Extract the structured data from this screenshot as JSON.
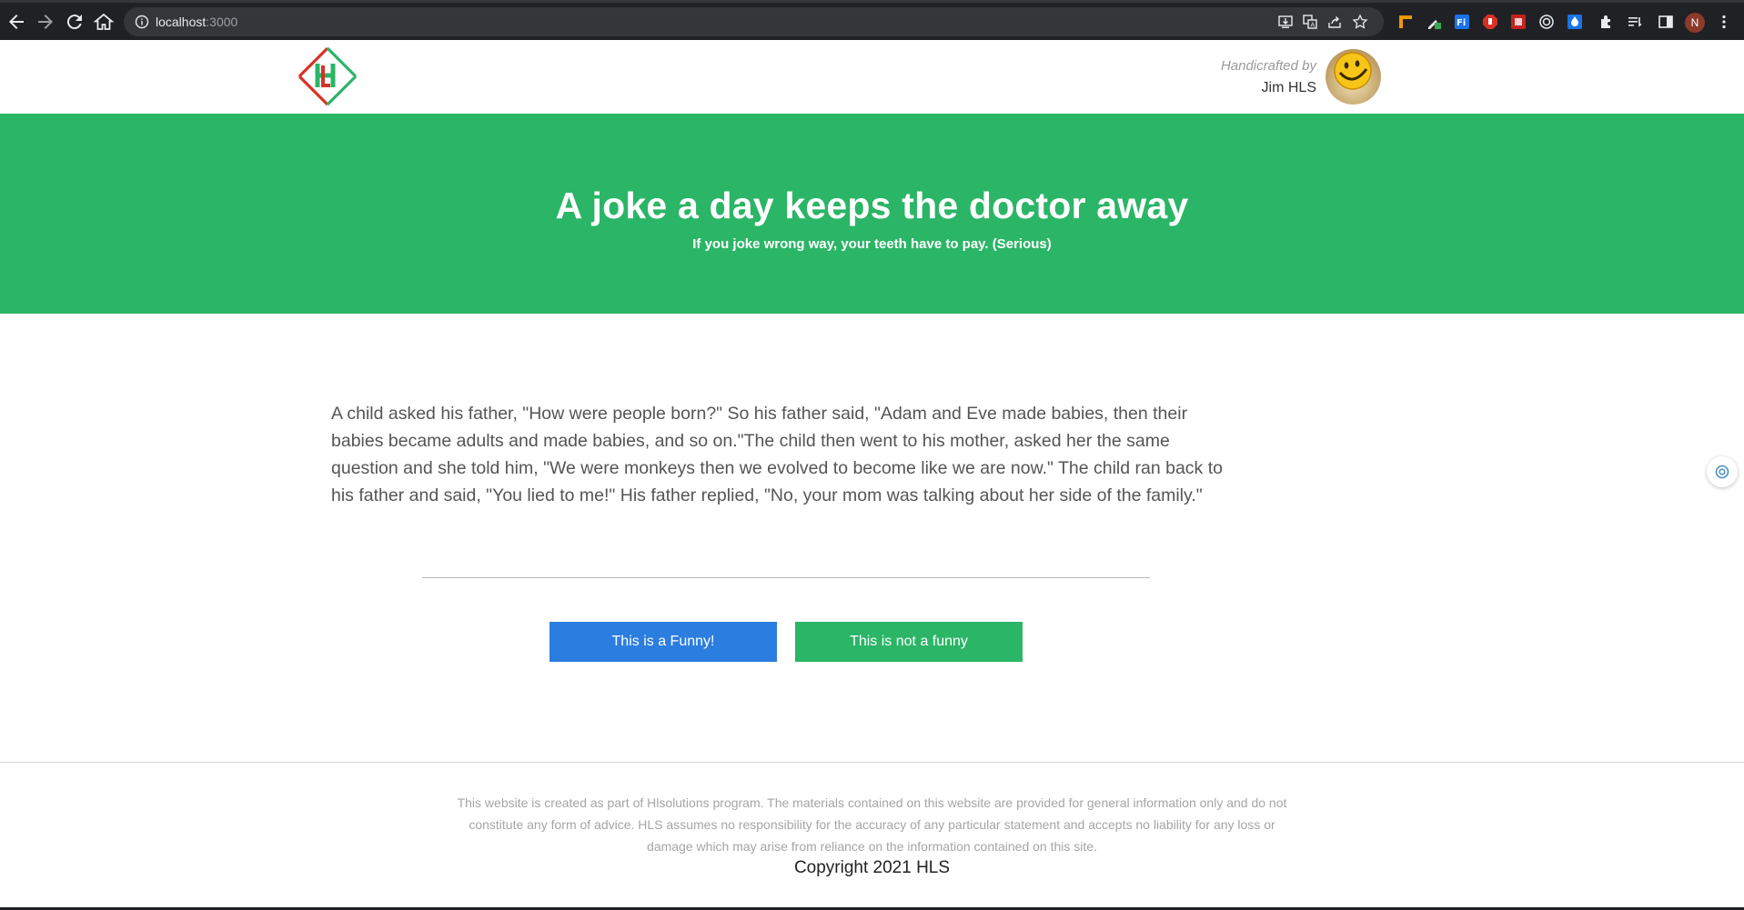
{
  "browser": {
    "url_host": "localhost",
    "url_port": ":3000",
    "profile_initial": "N"
  },
  "header": {
    "credit_by": "Handicrafted by",
    "credit_name": "Jim HLS"
  },
  "hero": {
    "title": "A joke a day keeps the doctor away",
    "subtitle": "If you joke wrong way, your teeth have to pay. (Serious)"
  },
  "joke": {
    "text": "A child asked his father, \"How were people born?\" So his father said, \"Adam and Eve made babies, then their babies became adults and made babies, and so on.\"The child then went to his mother, asked her the same question and she told him, \"We were monkeys then we evolved to become like we are now.\" The child ran back to his father and said, \"You lied to me!\" His father replied, \"No, your mom was talking about her side of the family.\""
  },
  "actions": {
    "funny_label": "This is a Funny!",
    "not_funny_label": "This is not a funny"
  },
  "footer": {
    "disclaimer": "This website is created as part of Hlsolutions program. The materials contained on this website are provided for general information only and do not constitute any form of advice. HLS assumes no responsibility for the accuracy of any particular statement and accepts no liability for any loss or damage which may arise from reliance on the information contained on this site.",
    "copyright": "Copyright 2021 HLS"
  },
  "colors": {
    "brand_green": "#2bb566",
    "button_blue": "#2b7de0",
    "chrome_dark": "#202124"
  },
  "icons": [
    "back-icon",
    "forward-icon",
    "reload-icon",
    "home-icon",
    "info-icon",
    "install-icon",
    "translate-icon",
    "share-icon",
    "star-icon",
    "extensions-icon",
    "sidebar-icon",
    "menu-icon"
  ]
}
